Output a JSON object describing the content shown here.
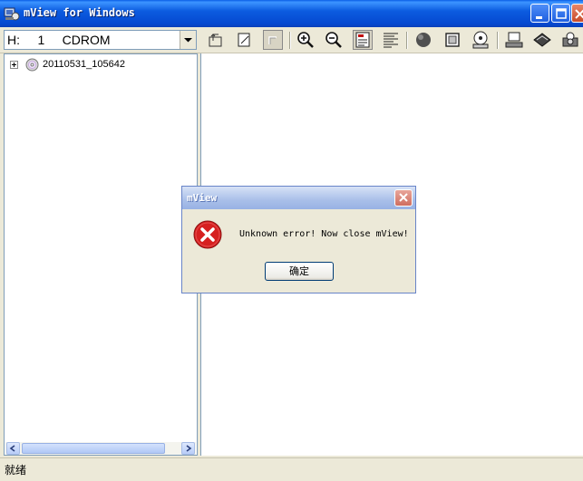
{
  "window": {
    "title": "mView for Windows"
  },
  "toolbar": {
    "drive_select": {
      "selected": "H:     1     CDROM"
    },
    "buttons": [
      "up-folder-icon",
      "copy-page-icon",
      "folder-disabled-icon",
      "zoom-in-icon",
      "zoom-out-icon",
      "properties-icon",
      "list-icon",
      "sphere-icon",
      "frame-icon",
      "disc-drive-icon",
      "computer-icon",
      "book-icon",
      "camera-icon"
    ]
  },
  "tree": {
    "items": [
      {
        "label": "20110531_105642"
      }
    ]
  },
  "status": {
    "text": "就绪"
  },
  "dialog": {
    "title": "mView",
    "message": "Unknown error! Now close mView!",
    "ok_label": "确定"
  },
  "colors": {
    "titlebar": "#0548d0",
    "dialog_title": "#a9bfe9",
    "error_red": "#d62020"
  }
}
